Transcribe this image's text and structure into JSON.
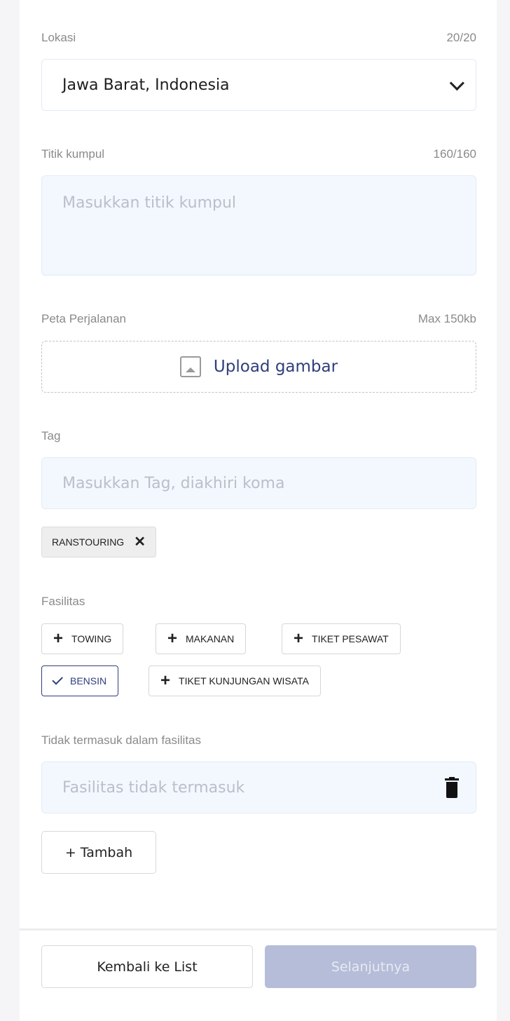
{
  "location": {
    "label": "Lokasi",
    "counter": "20/20",
    "value": "Jawa Barat, Indonesia",
    "icon": "chevron-down-icon"
  },
  "meeting_point": {
    "label": "Titik kumpul",
    "counter": "160/160",
    "placeholder": "Masukkan titik kumpul"
  },
  "route_map": {
    "label": "Peta Perjalanan",
    "limit": "Max 150kb",
    "upload_label": "Upload gambar",
    "icon": "image-icon"
  },
  "tags": {
    "label": "Tag",
    "placeholder": "Masukkan Tag, diakhiri koma",
    "chips": [
      {
        "label": "RANSTOURING",
        "remove_icon": "close-icon"
      }
    ]
  },
  "facilities": {
    "label": "Fasilitas",
    "options": [
      {
        "label": "TOWING",
        "selected": false
      },
      {
        "label": "MAKANAN",
        "selected": false
      },
      {
        "label": "TIKET PESAWAT",
        "selected": false
      },
      {
        "label": "BENSIN",
        "selected": true
      },
      {
        "label": "TIKET KUNJUNGAN WISATA",
        "selected": false
      }
    ]
  },
  "excluded": {
    "label": "Tidak termasuk dalam fasilitas",
    "placeholder": "Fasilitas tidak termasuk",
    "delete_icon": "trash-icon",
    "add_label": "+ Tambah"
  },
  "footer": {
    "back_label": "Kembali ke List",
    "next_label": "Selanjutnya"
  },
  "colors": {
    "accent": "#2f3e7d",
    "input_bg": "#f3f8ff",
    "disabled_button": "#b6bdd8"
  }
}
